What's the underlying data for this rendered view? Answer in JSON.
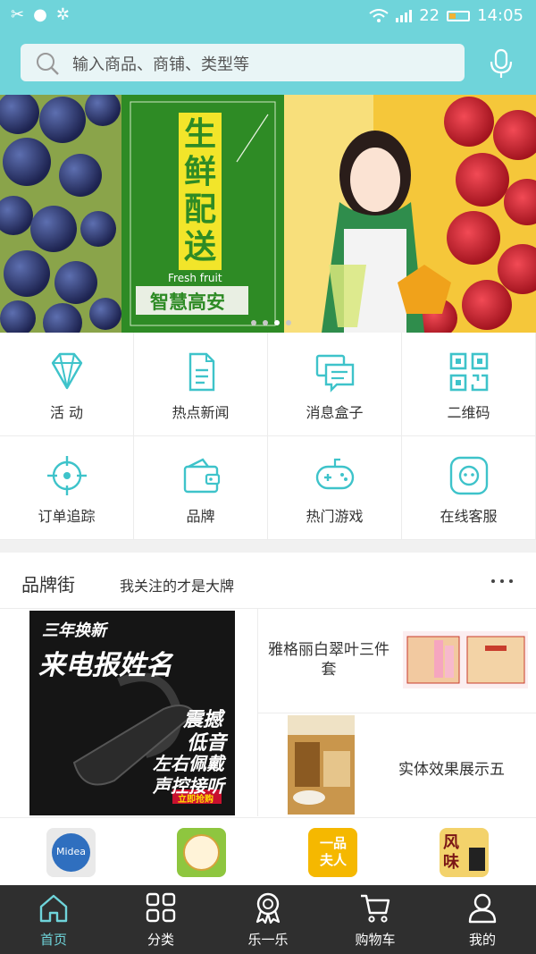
{
  "status_bar": {
    "signal_count": "22",
    "time": "14:05",
    "battery_level": 0.35
  },
  "search": {
    "placeholder": "输入商品、商铺、类型等"
  },
  "banner": {
    "vertical_text": [
      "生",
      "鲜",
      "配",
      "送"
    ],
    "en_text": "Fresh fruit",
    "brand_text": "智慧高安",
    "dots": 4,
    "active_dot": 3
  },
  "grid": [
    {
      "icon": "diamond-icon",
      "label": "活 动"
    },
    {
      "icon": "news-icon",
      "label": "热点新闻"
    },
    {
      "icon": "message-box-icon",
      "label": "消息盒子"
    },
    {
      "icon": "qrcode-icon",
      "label": "二维码"
    },
    {
      "icon": "crosshair-icon",
      "label": "订单追踪"
    },
    {
      "icon": "wallet-icon",
      "label": "品牌"
    },
    {
      "icon": "gamepad-icon",
      "label": "热门游戏"
    },
    {
      "icon": "support-icon",
      "label": "在线客服"
    }
  ],
  "brand_street": {
    "title": "品牌街",
    "subtitle": "我关注的才是大牌",
    "ad": {
      "line1": "三年换新",
      "line2": "来电报姓名",
      "line3": "震撼",
      "line4": "低音",
      "line5": "左右佩戴",
      "line6": "声控接听",
      "tag": "立即抢购"
    },
    "products": [
      {
        "name": "雅格丽白翠叶三件套"
      },
      {
        "name": "实体效果展示五"
      }
    ],
    "logos": [
      {
        "name": "midea-logo",
        "text": "Midea"
      },
      {
        "name": "food-logo",
        "text": ""
      },
      {
        "name": "yipin-furen-logo",
        "text": "一品夫人"
      },
      {
        "name": "fengwei-logo",
        "text": "风味"
      }
    ]
  },
  "tabbar": [
    {
      "icon": "home-icon",
      "label": "首页",
      "active": true
    },
    {
      "icon": "category-icon",
      "label": "分类",
      "active": false
    },
    {
      "icon": "award-icon",
      "label": "乐一乐",
      "active": false
    },
    {
      "icon": "cart-icon",
      "label": "购物车",
      "active": false
    },
    {
      "icon": "user-icon",
      "label": "我的",
      "active": false
    }
  ],
  "colors": {
    "accent": "#6fd4da",
    "tabbar": "#2f2f2f",
    "banner_green": "#2e8b25"
  }
}
